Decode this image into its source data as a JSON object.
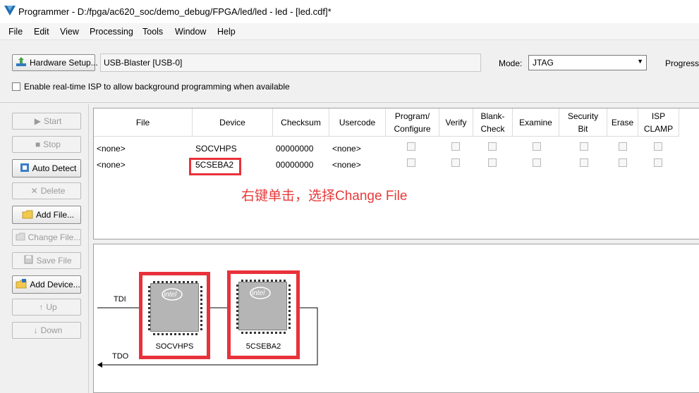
{
  "window": {
    "title": "Programmer - D:/fpga/ac620_soc/demo_debug/FPGA/led/led - led - [led.cdf]*"
  },
  "menu": [
    "File",
    "Edit",
    "View",
    "Processing",
    "Tools",
    "Window",
    "Help"
  ],
  "toolbar": {
    "hardware_setup_label": "Hardware Setup...",
    "hardware_value": "USB-Blaster [USB-0]",
    "mode_label": "Mode:",
    "mode_value": "JTAG",
    "progress_label": "Progress:",
    "isp_label": "Enable real-time ISP to allow background programming when available",
    "isp_checked": false
  },
  "side_buttons": [
    {
      "label": "Start",
      "icon": "play-icon",
      "enabled": false
    },
    {
      "label": "Stop",
      "icon": "stop-icon",
      "enabled": false
    },
    {
      "label": "Auto Detect",
      "icon": "auto-detect-icon",
      "enabled": true
    },
    {
      "label": "Delete",
      "icon": "delete-icon",
      "enabled": false
    },
    {
      "label": "Add File...",
      "icon": "add-file-icon",
      "enabled": true
    },
    {
      "label": "Change File...",
      "icon": "change-file-icon",
      "enabled": false
    },
    {
      "label": "Save File",
      "icon": "save-icon",
      "enabled": false
    },
    {
      "label": "Add Device...",
      "icon": "add-device-icon",
      "enabled": true
    },
    {
      "label": "Up",
      "icon": "up-icon",
      "enabled": false
    },
    {
      "label": "Down",
      "icon": "down-icon",
      "enabled": false
    }
  ],
  "table": {
    "columns": [
      "File",
      "Device",
      "Checksum",
      "Usercode",
      "Program/ Configure",
      "Verify",
      "Blank- Check",
      "Examine",
      "Security Bit",
      "Erase",
      "ISP CLAMP"
    ],
    "rows": [
      {
        "file": "<none>",
        "device": "SOCVHPS",
        "checksum": "00000000",
        "usercode": "<none>",
        "checks": [
          false,
          false,
          false,
          false,
          false,
          false,
          false
        ]
      },
      {
        "file": "<none>",
        "device": "5CSEBA2",
        "checksum": "00000000",
        "usercode": "<none>",
        "checks": [
          false,
          false,
          false,
          false,
          false,
          false,
          false
        ]
      }
    ]
  },
  "annotation": "右键单击，选择Change File",
  "chain": {
    "tdi_label": "TDI",
    "tdo_label": "TDO",
    "devices": [
      {
        "name": "SOCVHPS",
        "logo": "intel"
      },
      {
        "name": "5CSEBA2",
        "logo": "intel"
      }
    ]
  },
  "colors": {
    "highlight": "#e8323b",
    "annotation": "#e83a3a"
  }
}
